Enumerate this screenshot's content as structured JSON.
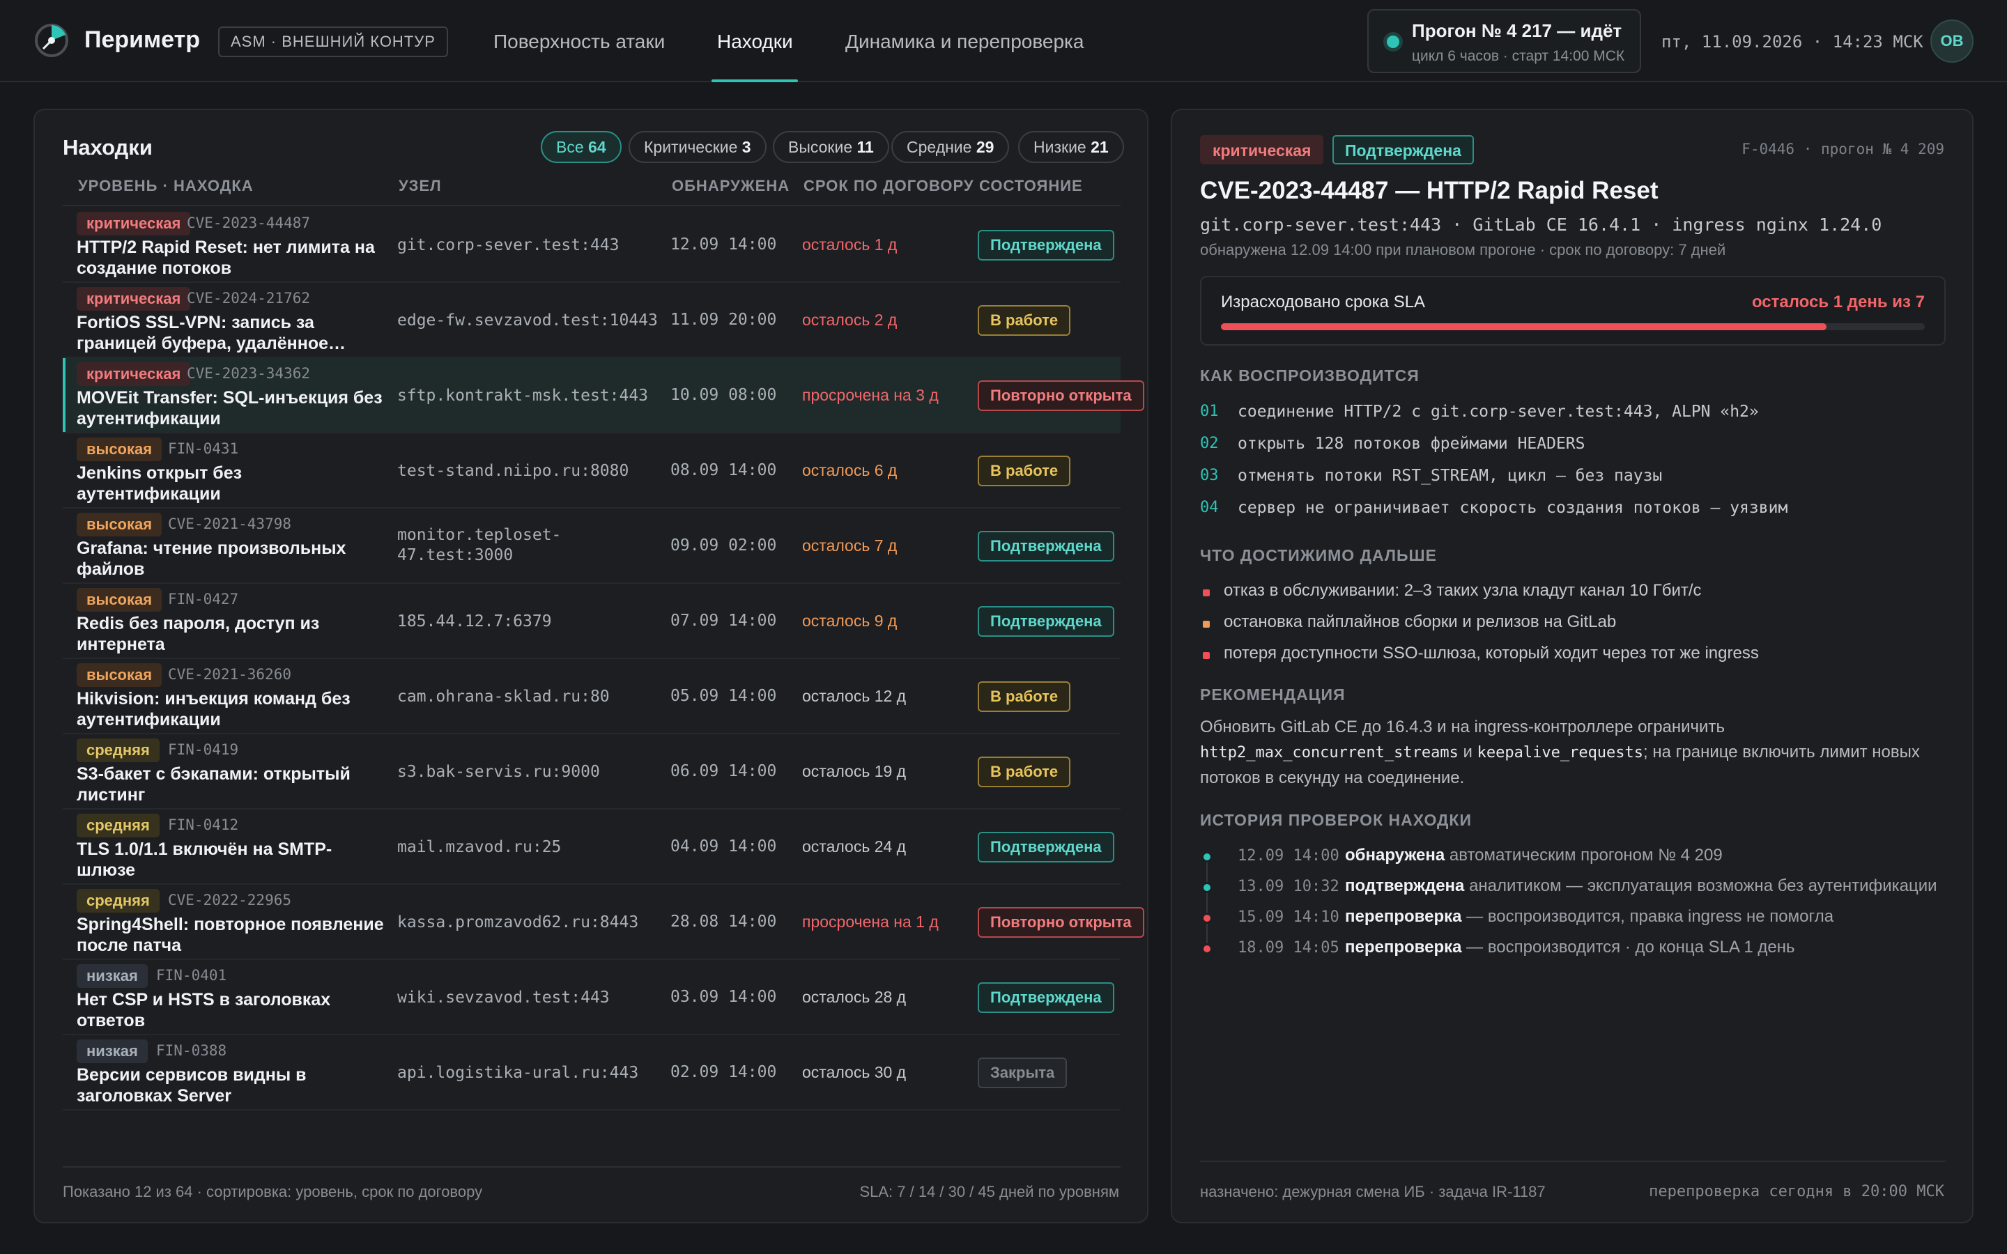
{
  "header": {
    "brand": "Периметр",
    "env_badge": "ASM · ВНЕШНИЙ КОНТУР",
    "tabs": [
      {
        "label": "Поверхность атаки"
      },
      {
        "label": "Находки"
      },
      {
        "label": "Динамика и перепроверка"
      }
    ],
    "run": {
      "title": "Прогон № 4 217 — идёт",
      "subtitle": "цикл 6 часов · старт 14:00 МСК"
    },
    "datetime": "пт, 11.09.2026 · 14:23 МСК",
    "avatar": "ОВ"
  },
  "findings": {
    "title": "Находки",
    "filters": [
      {
        "label": "Все",
        "count": "64"
      },
      {
        "label": "Критические",
        "count": "3"
      },
      {
        "label": "Высокие",
        "count": "11"
      },
      {
        "label": "Средние",
        "count": "29"
      },
      {
        "label": "Низкие",
        "count": "21"
      }
    ],
    "columns": [
      "УРОВЕНЬ · НАХОДКА",
      "УЗЕЛ",
      "ОБНАРУЖЕНА",
      "СРОК ПО ДОГОВОРУ",
      "СОСТОЯНИЕ"
    ],
    "rows": [
      {
        "severity": "критическая",
        "id": "CVE-2023-44487",
        "title": "HTTP/2 Rapid Reset: нет лимита на создание потоков",
        "host": "git.corp-sever.test:443",
        "found": "12.09 14:00",
        "sla": "осталось 1 д",
        "status": "Подтверждена"
      },
      {
        "severity": "критическая",
        "id": "CVE-2024-21762",
        "title": "FortiOS SSL-VPN: запись за границей буфера, удалённое…",
        "host": "edge-fw.sevzavod.test:10443",
        "found": "11.09 20:00",
        "sla": "осталось 2 д",
        "status": "В работе"
      },
      {
        "severity": "критическая",
        "id": "CVE-2023-34362",
        "title": "MOVEit Transfer: SQL-инъекция без аутентификации",
        "host": "sftp.kontrakt-msk.test:443",
        "found": "10.09 08:00",
        "sla": "просрочена на 3 д",
        "status": "Повторно открыта"
      },
      {
        "severity": "высокая",
        "id": "FIN-0431",
        "title": "Jenkins открыт без аутентификации",
        "host": "test-stand.niipo.ru:8080",
        "found": "08.09 14:00",
        "sla": "осталось 6 д",
        "status": "В работе"
      },
      {
        "severity": "высокая",
        "id": "CVE-2021-43798",
        "title": "Grafana: чтение произвольных файлов",
        "host": "monitor.teploset-47.test:3000",
        "found": "09.09 02:00",
        "sla": "осталось 7 д",
        "status": "Подтверждена"
      },
      {
        "severity": "высокая",
        "id": "FIN-0427",
        "title": "Redis без пароля, доступ из интернета",
        "host": "185.44.12.7:6379",
        "found": "07.09 14:00",
        "sla": "осталось 9 д",
        "status": "Подтверждена"
      },
      {
        "severity": "высокая",
        "id": "CVE-2021-36260",
        "title": "Hikvision: инъекция команд без аутентификации",
        "host": "cam.ohrana-sklad.ru:80",
        "found": "05.09 14:00",
        "sla": "осталось 12 д",
        "status": "В работе"
      },
      {
        "severity": "средняя",
        "id": "FIN-0419",
        "title": "S3-бакет с бэкапами: открытый листинг",
        "host": "s3.bak-servis.ru:9000",
        "found": "06.09 14:00",
        "sla": "осталось 19 д",
        "status": "В работе"
      },
      {
        "severity": "средняя",
        "id": "FIN-0412",
        "title": "TLS 1.0/1.1 включён на SMTP-шлюзе",
        "host": "mail.mzavod.ru:25",
        "found": "04.09 14:00",
        "sla": "осталось 24 д",
        "status": "Подтверждена"
      },
      {
        "severity": "средняя",
        "id": "CVE-2022-22965",
        "title": "Spring4Shell: повторное появление после патча",
        "host": "kassa.promzavod62.ru:8443",
        "found": "28.08 14:00",
        "sla": "просрочена на 1 д",
        "status": "Повторно открыта"
      },
      {
        "severity": "низкая",
        "id": "FIN-0401",
        "title": "Нет CSP и HSTS в заголовках ответов",
        "host": "wiki.sevzavod.test:443",
        "found": "03.09 14:00",
        "sla": "осталось 28 д",
        "status": "Подтверждена"
      },
      {
        "severity": "низкая",
        "id": "FIN-0388",
        "title": "Версии сервисов видны в заголовках Server",
        "host": "api.logistika-ural.ru:443",
        "found": "02.09 14:00",
        "sla": "осталось 30 д",
        "status": "Закрыта"
      }
    ],
    "footer_left": "Показано 12 из 64 · сортировка: уровень, срок по договору",
    "footer_right": "SLA: 7 / 14 / 30 / 45 дней по уровням"
  },
  "detail": {
    "severity": "критическая",
    "status": "Подтверждена",
    "meta": "F-0446 · прогон № 4 209",
    "title": "CVE-2023-44487 — HTTP/2 Rapid Reset",
    "subtitle": "git.corp-sever.test:443 · GitLab CE 16.4.1 · ingress nginx 1.24.0",
    "subtitle2": "обнаружена 12.09 14:00 при плановом прогоне · срок по договору: 7 дней",
    "sla_label": "Израсходовано срока SLA",
    "sla_left": "осталось 1 день из 7",
    "sla_used_fraction": 0.86,
    "repro_title": "КАК ВОСПРОИЗВОДИТСЯ",
    "steps": [
      {
        "num": "01",
        "text": "соединение HTTP/2 с git.corp-sever.test:443, ALPN «h2»"
      },
      {
        "num": "02",
        "text": "открыть 128 потоков фреймами HEADERS"
      },
      {
        "num": "03",
        "text": "отменять потоки RST_STREAM, цикл — без паузы"
      },
      {
        "num": "04",
        "text": "сервер не ограничивает скорость создания потоков — уязвим"
      }
    ],
    "impact_title": "ЧТО ДОСТИЖИМО ДАЛЬШЕ",
    "impacts": [
      {
        "text": "отказ в обслуживании: 2–3 таких узла кладут канал 10 Гбит/с",
        "color": "#ef4f57"
      },
      {
        "text": "остановка пайплайнов сборки и релизов на GitLab",
        "color": "#f29a55"
      },
      {
        "text": "потеря доступности SSO-шлюза, который ходит через тот же ingress",
        "color": "#ef4f57"
      }
    ],
    "rec_title": "РЕКОМЕНДАЦИЯ",
    "rec": {
      "part1": "Обновить GitLab CE до 16.4.3 и на ingress-контроллере ограничить ",
      "code1": "http2_max_concurrent_streams",
      "part2": " и ",
      "code2": "keepalive_requests",
      "part3": "; на границе включить лимит новых потоков в секунду на соединение."
    },
    "history_title": "ИСТОРИЯ ПРОВЕРОК НАХОДКИ",
    "history": [
      {
        "time": "12.09 14:00",
        "action": "обнаружена",
        "text": " автоматическим прогоном № 4 209",
        "color": "#2ec4b6"
      },
      {
        "time": "13.09 10:32",
        "action": "подтверждена",
        "text": " аналитиком — эксплуатация возможна без аутентификации",
        "color": "#2ec4b6"
      },
      {
        "time": "15.09 14:10",
        "action": "перепроверка",
        "text": " — воспроизводится, правка ingress не помогла",
        "color": "#ef4f57"
      },
      {
        "time": "18.09 14:05",
        "action": "перепроверка",
        "text": " — воспроизводится · до конца SLA 1 день",
        "color": "#ef4f57"
      }
    ],
    "footer_left": "назначено: дежурная смена ИБ · задача IR-1187",
    "footer_right": "перепроверка сегодня в 20:00 МСК"
  }
}
